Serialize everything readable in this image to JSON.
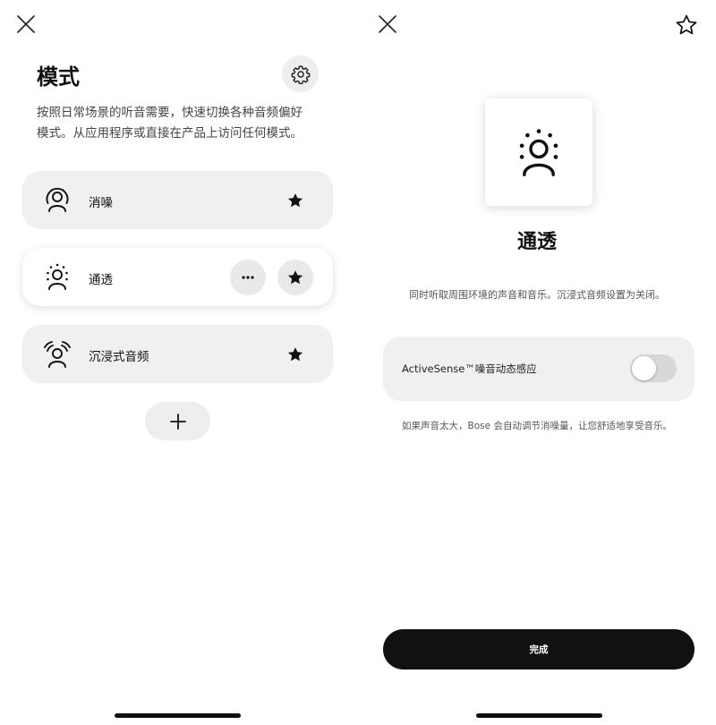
{
  "modes_screen": {
    "close_icon": "close-icon",
    "title": "模式",
    "settings_icon": "gear-icon",
    "description": "按照日常场景的听音需要，快速切换各种音频偏好模式。从应用程序或直接在产品上访问任何模式。",
    "modes": [
      {
        "label": "消噪",
        "icon": "noise-cancel-icon",
        "favorite": true,
        "selected": false
      },
      {
        "label": "通透",
        "icon": "aware-icon",
        "favorite": true,
        "selected": true
      },
      {
        "label": "沉浸式音频",
        "icon": "immersive-audio-icon",
        "favorite": true,
        "selected": false
      }
    ],
    "more_icon": "more-icon",
    "add_icon": "plus-icon"
  },
  "mode_detail": {
    "close_icon": "close-icon",
    "favorite_icon": "star-outline-icon",
    "mode_icon": "aware-icon",
    "title": "通透",
    "description": "同时听取周围环境的声音和音乐。沉浸式音频设置为关闭。",
    "activesense_label": "ActiveSense™噪音动态感应",
    "activesense_on": false,
    "hint": "如果声音太大，Bose 会自动调节消噪量，让您舒适地享受音乐。",
    "done_label": "完成"
  },
  "colors": {
    "background": "#ffffff",
    "card": "#f0f0f0",
    "primary_button": "#111111",
    "toggle_off": "#d8d8d8"
  }
}
